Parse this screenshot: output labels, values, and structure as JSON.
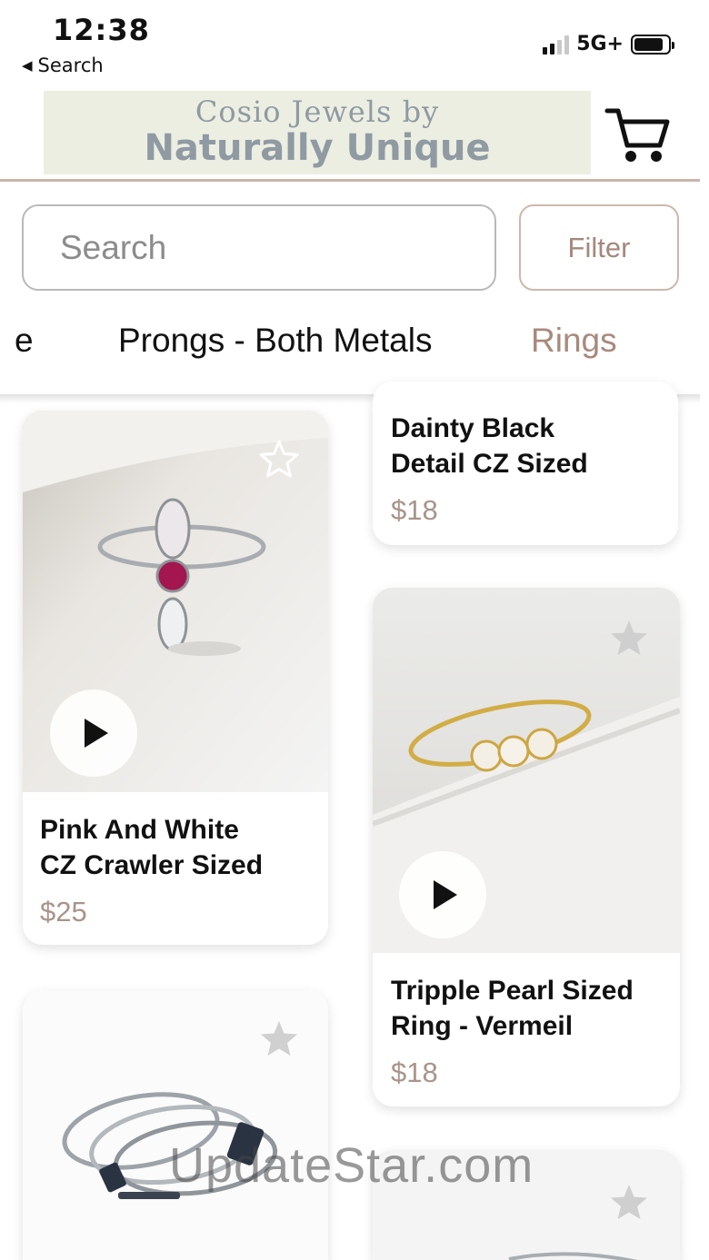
{
  "status_bar": {
    "time": "12:38",
    "back_label": "Search",
    "network": "5G+"
  },
  "header": {
    "banner_line1": "Cosio Jewels by",
    "banner_line2": "Naturally Unique",
    "cart_icon": "cart-icon"
  },
  "search": {
    "placeholder": "Search",
    "filter_label": "Filter"
  },
  "tabs": [
    {
      "label": "e"
    },
    {
      "label": "Prongs - Both Metals"
    },
    {
      "label": "Rings",
      "selected": true
    }
  ],
  "products": [
    {
      "title_line1": "Pink And White",
      "title_line2": "CZ Crawler Sized",
      "price": "$25",
      "has_video": true
    },
    {
      "title_line1": "Dainty Black",
      "title_line2": "Detail CZ  Sized",
      "price": "$18"
    },
    {
      "title_line1": "Tripple Pearl Sized",
      "title_line2": "Ring - Vermeil",
      "price": "$18",
      "has_video": true
    },
    {
      "title_line1": "",
      "title_line2": "",
      "price": ""
    },
    {
      "title_line1": "",
      "title_line2": "",
      "price": ""
    }
  ],
  "watermark": "UpdateStar.com",
  "colors": {
    "accent": "#b39587",
    "price": "#a8948a",
    "banner_bg": "#eceee2",
    "banner_text": "#8f9aa3"
  }
}
